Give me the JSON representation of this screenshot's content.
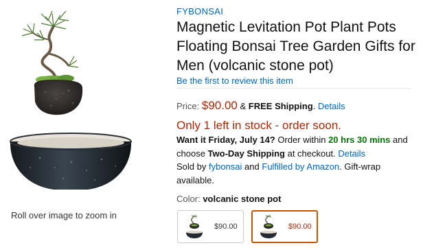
{
  "image": {
    "zoom_hint": "Roll over image to zoom in"
  },
  "product": {
    "brand": "FYBONSAI",
    "title": "Magnetic Levitation Pot Plant Pots Floating Bonsai Tree Garden Gifts for Men (volcanic stone pot)",
    "review_link": "Be the first to review this item"
  },
  "price": {
    "label": "Price:",
    "amount": "$90.00",
    "amp": "&",
    "free_shipping": "FREE Shipping",
    "period": ".",
    "details_link": "Details"
  },
  "stock": {
    "message": "Only 1 left in stock - order soon."
  },
  "delivery": {
    "want_it": "Want it Friday, July 14?",
    "order_within": "Order within",
    "countdown": "20 hrs 30 mins",
    "and": "and",
    "choose": "choose",
    "shipping_method": "Two-Day Shipping",
    "at_checkout": "at checkout.",
    "details_link": "Details",
    "sold_by": "Sold by",
    "seller": "fybonsai",
    "and2": "and",
    "fulfilled": "Fulfilled by Amazon",
    "gift_wrap": ". Gift-wrap available."
  },
  "color": {
    "label": "Color:",
    "selected": "volcanic stone pot"
  },
  "swatches": [
    {
      "price": "$90.00",
      "selected": false
    },
    {
      "price": "$90.00",
      "selected": true
    }
  ],
  "colors": {
    "link": "#0066c0",
    "price": "#b12704",
    "stock": "#b12704",
    "countdown": "#007600",
    "selected_border": "#c45500"
  }
}
